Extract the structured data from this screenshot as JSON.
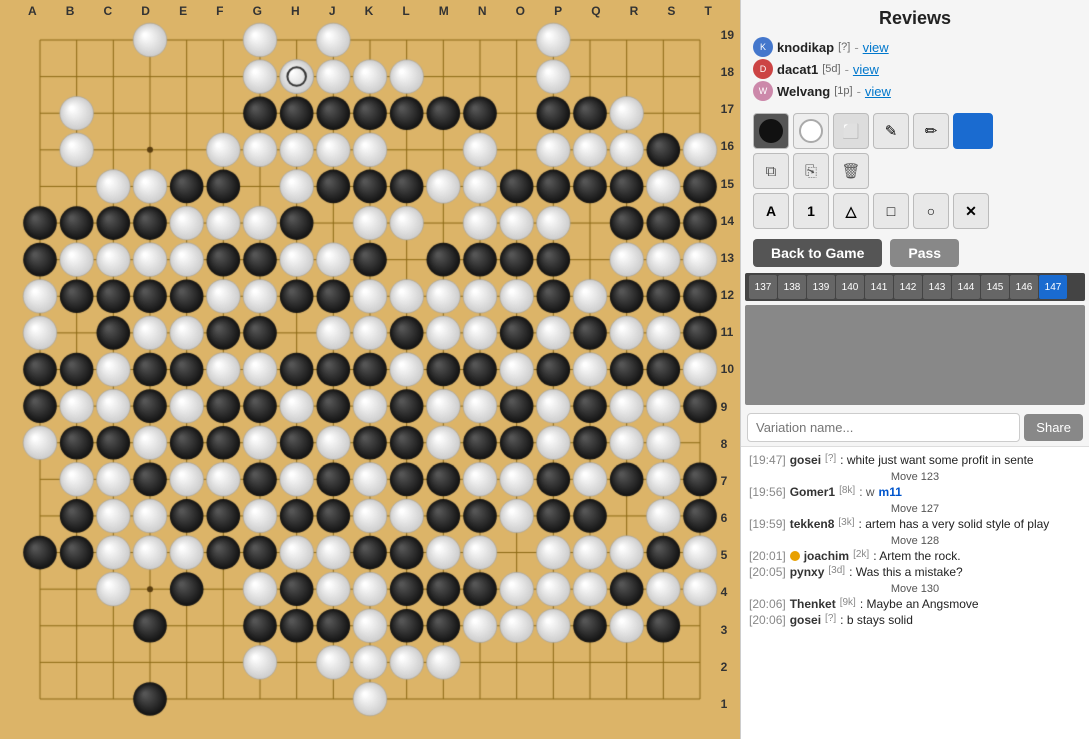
{
  "title": "Reviews",
  "reviewers": [
    {
      "name": "knodikap",
      "rank": "?",
      "view": "view",
      "color": "blue"
    },
    {
      "name": "dacat1",
      "rank": "5d",
      "view": "view",
      "color": "red"
    },
    {
      "name": "Welvang",
      "rank": "1p",
      "view": "view",
      "color": "pink"
    }
  ],
  "tools": {
    "stone_black": "⬤",
    "stone_white": "○",
    "eraser": "✎",
    "pen": "✏",
    "blue_rect": ""
  },
  "icon_buttons": {
    "copy1": "⧉",
    "copy2": "⎘",
    "delete": "🗑"
  },
  "mark_buttons": [
    "A",
    "1",
    "△",
    "□",
    "○",
    "✕"
  ],
  "back_to_game": "Back to Game",
  "pass": "Pass",
  "move_chips": [
    "137",
    "138",
    "139",
    "140",
    "141",
    "142",
    "143",
    "144",
    "145",
    "146",
    "147"
  ],
  "active_chip": "147",
  "variation_placeholder": "Variation name...",
  "share_label": "Share",
  "chat": [
    {
      "type": "text",
      "time": "[19:47]",
      "user": "gosei",
      "rank": "?",
      "text": ": white just want some profit in sente"
    },
    {
      "type": "move_label",
      "label": "Move 123"
    },
    {
      "type": "move_ref",
      "time": "[19:56]",
      "user": "Gomer1",
      "rank": "8k",
      "color": "w",
      "move": "m11"
    },
    {
      "type": "move_label",
      "label": "Move 127"
    },
    {
      "type": "text",
      "time": "[19:59]",
      "user": "tekken8",
      "rank": "3k",
      "text": ": artem has a very solid style of play"
    },
    {
      "type": "move_label",
      "label": "Move 128"
    },
    {
      "type": "text",
      "time": "[20:01]",
      "user": "joachim",
      "rank": "2k",
      "dot": true,
      "text": ": Artem the rock."
    },
    {
      "type": "text",
      "time": "[20:05]",
      "user": "pynxy",
      "rank": "3d",
      "text": ": Was this a mistake?"
    },
    {
      "type": "move_label",
      "label": "Move 130"
    },
    {
      "type": "text",
      "time": "[20:06]",
      "user": "Thenket",
      "rank": "9k",
      "text": ": Maybe an Angsmove"
    },
    {
      "type": "text",
      "time": "[20:06]",
      "user": "gosei",
      "rank": "?",
      "text": ": b stays solid"
    }
  ],
  "board": {
    "cols": [
      "A",
      "B",
      "C",
      "D",
      "E",
      "F",
      "G",
      "H",
      "J",
      "K",
      "L",
      "M",
      "N",
      "O",
      "P",
      "Q",
      "R",
      "S",
      "T"
    ],
    "rows": [
      19,
      18,
      17,
      16,
      15,
      14,
      13,
      12,
      11,
      10,
      9,
      8,
      7,
      6,
      5,
      4,
      3,
      2,
      1
    ]
  }
}
